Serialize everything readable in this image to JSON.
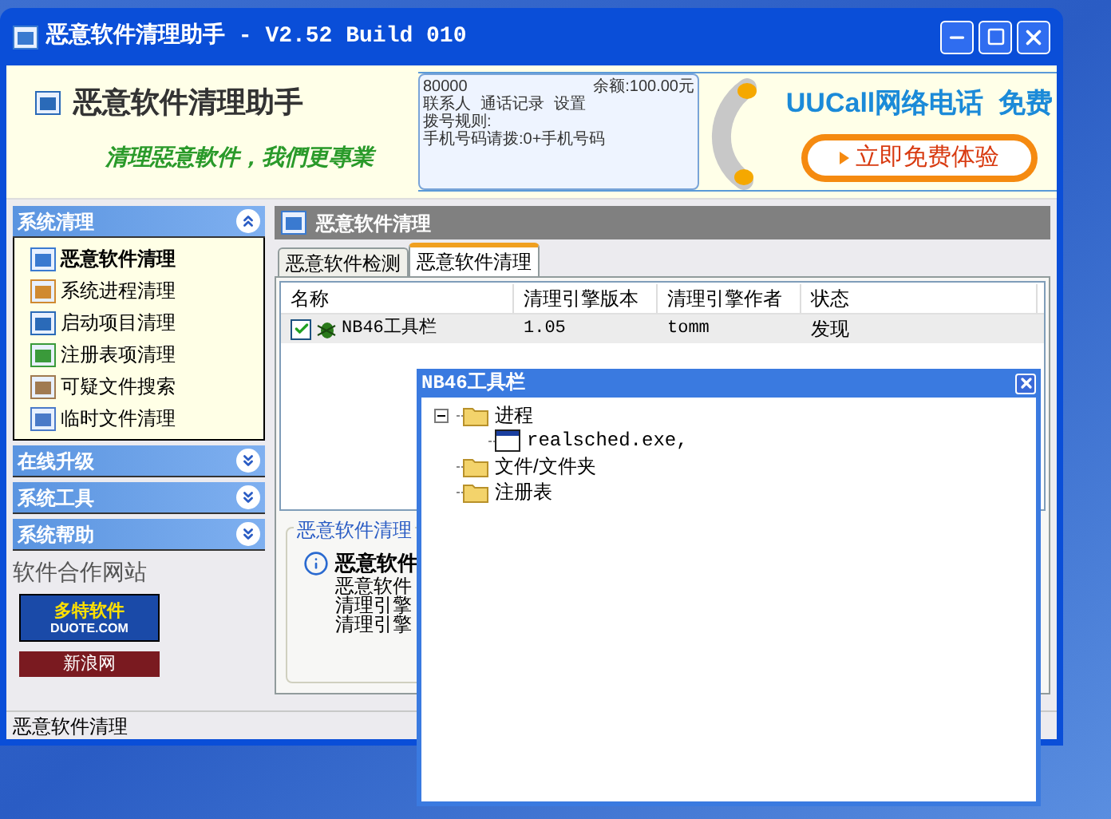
{
  "window": {
    "title": "恶意软件清理助手 - V2.52 Build 010"
  },
  "header": {
    "app_name": "恶意软件清理助手",
    "slogan": "清理惡意軟件，我們更專業",
    "ad": {
      "mini_app": [
        "80000",
        "余额:100.00元",
        "联系人",
        "通话记录",
        "设置",
        "拨号规则:",
        "手机号码请拨:0+手机号码"
      ],
      "headline": "UUCall网络电话  免费",
      "button": "立即免费体验"
    }
  },
  "sidebar": {
    "sections": [
      {
        "title": "系统清理",
        "expanded": true,
        "items": [
          {
            "label": "恶意软件清理",
            "selected": true
          },
          {
            "label": "系统进程清理",
            "selected": false
          },
          {
            "label": "启动项目清理",
            "selected": false
          },
          {
            "label": "注册表项清理",
            "selected": false
          },
          {
            "label": "可疑文件搜索",
            "selected": false
          },
          {
            "label": "临时文件清理",
            "selected": false
          }
        ]
      },
      {
        "title": "在线升级",
        "expanded": false
      },
      {
        "title": "系统工具",
        "expanded": false
      },
      {
        "title": "系统帮助",
        "expanded": false
      }
    ],
    "partners_label": "软件合作网站",
    "partner_banners": [
      {
        "text": "多特软件",
        "subtext": "DUOTE.COM"
      },
      {
        "text": "新浪网"
      }
    ]
  },
  "content": {
    "title": "恶意软件清理",
    "tabs": [
      {
        "label": "恶意软件检测",
        "selected": false
      },
      {
        "label": "恶意软件清理",
        "selected": true
      }
    ],
    "table": {
      "columns": [
        "名称",
        "清理引擎版本",
        "清理引擎作者",
        "状态"
      ],
      "rows": [
        {
          "checked": true,
          "selected": true,
          "cells": [
            "NB46工具栏",
            "1.05",
            "tomm",
            "发现"
          ]
        }
      ]
    },
    "info": {
      "legend": "恶意软件清理",
      "heading": "恶意软件",
      "lines": [
        "恶意软件",
        "清理引擎",
        "清理引擎"
      ]
    }
  },
  "status_bar": "恶意软件清理",
  "popup": {
    "title": "NB46工具栏",
    "tree": [
      {
        "label": "进程",
        "kind": "folder",
        "expanded": true,
        "children": [
          {
            "label": "realsched.exe,",
            "kind": "program"
          }
        ]
      },
      {
        "label": "文件/文件夹",
        "kind": "folder"
      },
      {
        "label": "注册表",
        "kind": "folder"
      }
    ]
  }
}
